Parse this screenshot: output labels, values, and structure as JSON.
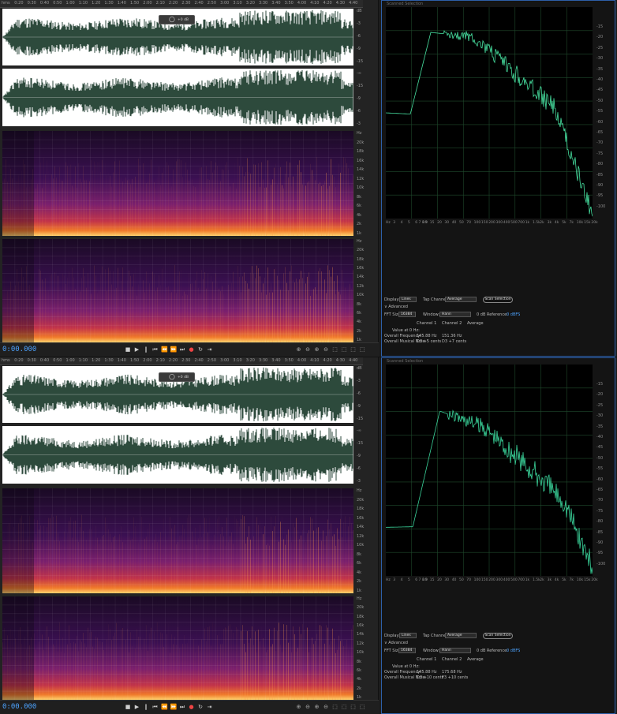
{
  "ruler_labels": [
    "hms",
    "0:20",
    "0:30",
    "0:40",
    "0:50",
    "1:00",
    "1:10",
    "1:20",
    "1:30",
    "1:40",
    "1:50",
    "2:00",
    "2:10",
    "2:20",
    "2:30",
    "2:40",
    "2:50",
    "3:00",
    "3:10",
    "3:20",
    "3:30",
    "3:40",
    "3:50",
    "4:00",
    "4:10",
    "4:20",
    "4:30",
    "4:40"
  ],
  "db_scale": [
    "dB",
    "-3",
    "-6",
    "-9",
    "-15",
    "-∞",
    "-15",
    "-9",
    "-6",
    "-3"
  ],
  "spec_scale": [
    "Hz",
    "20k",
    "18k",
    "16k",
    "14k",
    "12k",
    "10k",
    "8k",
    "6k",
    "4k",
    "2k",
    "1k"
  ],
  "hud_label": "+0 dB",
  "timecode": "0:00.000",
  "transport_icons": [
    "stop-icon",
    "play-icon",
    "pause-icon",
    "skip-back-icon",
    "rewind-icon",
    "fast-forward-icon",
    "skip-forward-icon",
    "record-icon",
    "loop-icon",
    "skip-selection-icon"
  ],
  "zoom_icons": [
    "zoom-in-amplitude-icon",
    "zoom-out-amplitude-icon",
    "zoom-in-time-icon",
    "zoom-out-time-icon",
    "zoom-full-icon",
    "zoom-in-selection-icon",
    "zoom-in-left-icon",
    "zoom-in-right-icon"
  ],
  "panel_title": "Scanned Selection",
  "db_axis": [
    "-15",
    "-20",
    "-25",
    "-30",
    "-35",
    "-40",
    "-45",
    "-50",
    "-55",
    "-60",
    "-65",
    "-70",
    "-75",
    "-80",
    "-85",
    "-90",
    "-95",
    "-100"
  ],
  "hz_axis": [
    "Hz",
    "3",
    "4",
    "5",
    "6 7 8 9",
    "10",
    "15",
    "20",
    "30",
    "40",
    "50",
    "70",
    "100",
    "150",
    "200",
    "300",
    "400",
    "500",
    "700",
    "1k",
    "1.5k",
    "2k",
    "3k",
    "4k",
    "5k",
    "7k",
    "10k",
    "15k",
    "20k"
  ],
  "display_label": "Display:",
  "display_value": "Lines",
  "tap_label": "Tap Channel:",
  "tap_value": "Average",
  "scan_button": "Scan Selection",
  "advanced_label": "Advanced",
  "fft_label": "FFT Size:",
  "fft_value": "16384",
  "window_label": "Window:",
  "window_value": "Hann",
  "reference_label": "0 dB Reference:",
  "reference_value": "0 dBFS",
  "col_channel1": "Channel 1",
  "col_channel2": "Channel 2",
  "col_average": "Average",
  "row_value_label": "Value at 0 Hz:",
  "row_freq_label": "Overall Frequency:",
  "row_note_label": "Overall Musical Note:",
  "top": {
    "freq_ch1": "145.88 Hz",
    "freq_ch2": "151.36 Hz",
    "note_ch1": "D3 +5 cents",
    "note_ch2": "D3 +7 cents",
    "curve_color": "#47e0a0"
  },
  "bottom": {
    "freq_ch1": "145.88 Hz",
    "freq_ch2": "175.68 Hz",
    "note_ch1": "D3 +10 cents",
    "note_ch2": "F3 +10 cents",
    "curve_color": "#3ad39a"
  },
  "colors": {
    "accent": "#4da3ff",
    "waveform": "#2d4a3c",
    "panel_border": "#2d5fa8"
  }
}
